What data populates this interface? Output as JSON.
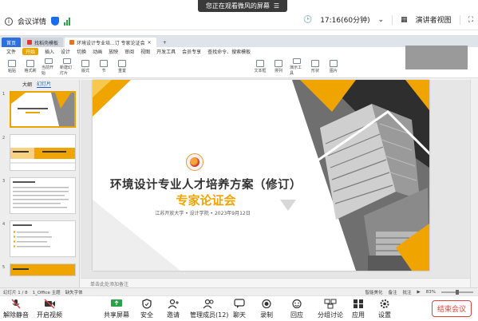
{
  "top_banner": {
    "text": "您正在观看微风的屏幕",
    "menu_icon": "menu-icon"
  },
  "meeting_info": {
    "label": "会议详情",
    "icons": [
      "info-icon",
      "shield-icon",
      "signal-icon"
    ]
  },
  "meeting_right": {
    "time": "17:16(60分钟)",
    "view_label": "演讲者视图",
    "icons": [
      "clock-icon",
      "grid-icon",
      "fullscreen-icon"
    ]
  },
  "wps": {
    "tabs": [
      {
        "label": "首页"
      },
      {
        "label": "找稻壳模板"
      },
      {
        "label": "环境设计专业培...订 专家论证会"
      }
    ],
    "menus": [
      "文件",
      "开始",
      "插入",
      "设计",
      "切换",
      "动画",
      "放映",
      "审阅",
      "视图",
      "开发工具",
      "会员专享",
      "查找命令、搜索模板"
    ],
    "ribbon_buttons": [
      "粘贴",
      "格式刷",
      "当前开始",
      "新建幻灯片",
      "版式",
      "节",
      "重置",
      "文本框",
      "排列",
      "演示工具",
      "形状",
      "图片"
    ],
    "pane_tabs": [
      "大纲",
      "幻灯片"
    ],
    "thumbnails": [
      "1",
      "2",
      "3",
      "4",
      "5"
    ],
    "notes_placeholder": "单击此处添加备注",
    "status": {
      "slide_info": "幻灯片 1 / 8",
      "theme": "1_Office 主题",
      "font_missing": "缺失字体",
      "right_items": [
        "智能美化",
        "备注",
        "批注"
      ],
      "zoom": "83%"
    }
  },
  "slide": {
    "title": "环境设计专业人才培养方案（修订）",
    "subtitle": "专家论证会",
    "meta": "江苏开放大学 • 设计学院 • 2023年9月12日"
  },
  "toolbar": [
    {
      "label": "解除静音",
      "icon": "mic-muted-icon"
    },
    {
      "label": "开启视频",
      "icon": "camera-off-icon"
    },
    {
      "label": "共享屏幕",
      "icon": "share-screen-icon"
    },
    {
      "label": "安全",
      "icon": "shield-icon"
    },
    {
      "label": "邀请",
      "icon": "invite-icon"
    },
    {
      "label": "管理成员(12)",
      "icon": "members-icon"
    },
    {
      "label": "聊天",
      "icon": "chat-icon"
    },
    {
      "label": "录制",
      "icon": "record-icon"
    },
    {
      "label": "回应",
      "icon": "emoji-icon"
    },
    {
      "label": "分组讨论",
      "icon": "breakout-icon"
    },
    {
      "label": "应用",
      "icon": "apps-icon"
    },
    {
      "label": "设置",
      "icon": "settings-icon"
    }
  ],
  "end_meeting": "结束会议",
  "colors": {
    "accent": "#f0a400",
    "brand_blue": "#1a6cf0",
    "end_red": "#e0443e",
    "wps_blue": "#2f6fdd"
  }
}
